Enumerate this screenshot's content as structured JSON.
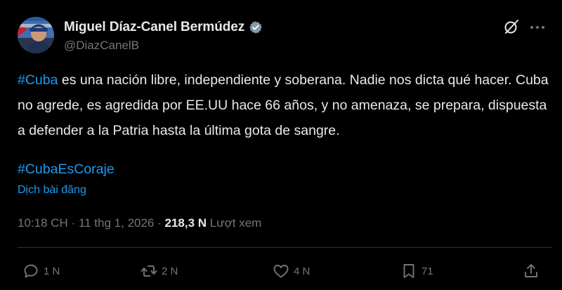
{
  "author": {
    "display_name": "Miguel Díaz-Canel Bermúdez",
    "handle": "@DiazCanelB",
    "verified": true
  },
  "post": {
    "hashtag_1": "#Cuba",
    "text_1": " es una nación libre, independiente y soberana. Nadie nos dicta qué hacer. Cuba no agrede, es agredida por EE.UU hace 66 años, y no amenaza, se prepara, dispuesta a defender a la Patria hasta la última gota de sangre.",
    "hashtag_2": "#CubaEsCoraje",
    "translate_label": "Dịch bài đăng"
  },
  "meta": {
    "time": "10:18 CH",
    "separator_1": " · ",
    "date": "11 thg 1, 2026",
    "separator_2": " · ",
    "views_count": "218,3 N",
    "views_label": " Lượt xem"
  },
  "actions": {
    "replies": "1 N",
    "reposts": "2 N",
    "likes": "4 N",
    "bookmarks": "71"
  },
  "colors": {
    "background": "#000000",
    "text": "#e7e9ea",
    "muted": "#71767b",
    "accent": "#1d9bf0"
  },
  "icons": [
    "avatar",
    "verified-badge-icon",
    "grok-icon",
    "more-icon",
    "reply-icon",
    "repost-icon",
    "like-icon",
    "bookmark-icon",
    "share-icon"
  ]
}
